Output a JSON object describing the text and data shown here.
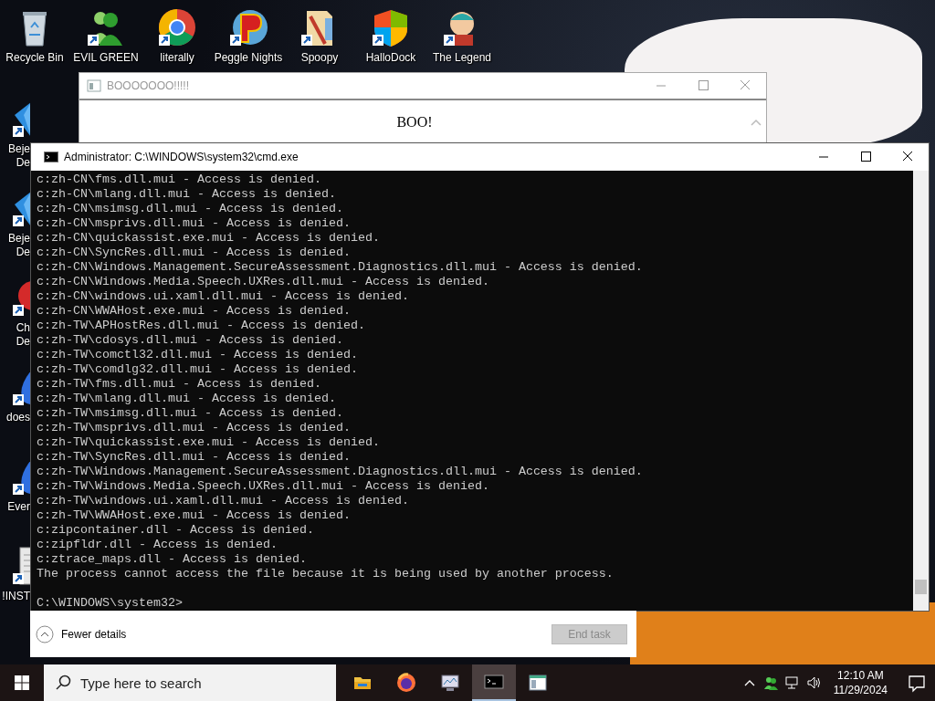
{
  "desktop": {
    "icons": [
      {
        "kind": "recycle_bin",
        "label_lines": [
          "Recycle Bin"
        ]
      },
      {
        "kind": "people",
        "label_lines": [
          "EVIL GREEN"
        ]
      },
      {
        "kind": "chrome",
        "label_lines": [
          "literally"
        ]
      },
      {
        "kind": "peggle",
        "label_lines": [
          "Peggle Nights"
        ]
      },
      {
        "kind": "folder",
        "label_lines": [
          "Spoopy"
        ]
      },
      {
        "kind": "shield",
        "label_lines": [
          "HalloDock"
        ]
      },
      {
        "kind": "character",
        "label_lines": [
          "The Legend"
        ]
      }
    ],
    "side_icons": [
      {
        "kind": "gem",
        "label_lines": [
          "Beje",
          "De"
        ]
      },
      {
        "kind": "gem",
        "label_lines": [
          "Beje",
          "De"
        ]
      },
      {
        "kind": "ball",
        "label_lines": [
          "Ch",
          "De"
        ]
      },
      {
        "kind": "flame",
        "label_lines": [
          "does"
        ]
      },
      {
        "kind": "flame",
        "label_lines": [
          "Ever"
        ]
      },
      {
        "kind": "file",
        "label_lines": [
          "!INST"
        ]
      }
    ]
  },
  "boo_window": {
    "title": "BOOOOOOO!!!!!",
    "message": "BOO!"
  },
  "cmd_window": {
    "title": "Administrator: C:\\WINDOWS\\system32\\cmd.exe",
    "lines": [
      "c:zh-CN\\fms.dll.mui - Access is denied.",
      "c:zh-CN\\mlang.dll.mui - Access is denied.",
      "c:zh-CN\\msimsg.dll.mui - Access is denied.",
      "c:zh-CN\\msprivs.dll.mui - Access is denied.",
      "c:zh-CN\\quickassist.exe.mui - Access is denied.",
      "c:zh-CN\\SyncRes.dll.mui - Access is denied.",
      "c:zh-CN\\Windows.Management.SecureAssessment.Diagnostics.dll.mui - Access is denied.",
      "c:zh-CN\\Windows.Media.Speech.UXRes.dll.mui - Access is denied.",
      "c:zh-CN\\windows.ui.xaml.dll.mui - Access is denied.",
      "c:zh-CN\\WWAHost.exe.mui - Access is denied.",
      "c:zh-TW\\APHostRes.dll.mui - Access is denied.",
      "c:zh-TW\\cdosys.dll.mui - Access is denied.",
      "c:zh-TW\\comctl32.dll.mui - Access is denied.",
      "c:zh-TW\\comdlg32.dll.mui - Access is denied.",
      "c:zh-TW\\fms.dll.mui - Access is denied.",
      "c:zh-TW\\mlang.dll.mui - Access is denied.",
      "c:zh-TW\\msimsg.dll.mui - Access is denied.",
      "c:zh-TW\\msprivs.dll.mui - Access is denied.",
      "c:zh-TW\\quickassist.exe.mui - Access is denied.",
      "c:zh-TW\\SyncRes.dll.mui - Access is denied.",
      "c:zh-TW\\Windows.Management.SecureAssessment.Diagnostics.dll.mui - Access is denied.",
      "c:zh-TW\\Windows.Media.Speech.UXRes.dll.mui - Access is denied.",
      "c:zh-TW\\windows.ui.xaml.dll.mui - Access is denied.",
      "c:zh-TW\\WWAHost.exe.mui - Access is denied.",
      "c:zipcontainer.dll - Access is denied.",
      "c:zipfldr.dll - Access is denied.",
      "c:ztrace_maps.dll - Access is denied.",
      "The process cannot access the file because it is being used by another process."
    ],
    "prompt": "C:\\WINDOWS\\system32>"
  },
  "task_panel": {
    "details_link": "Fewer details",
    "end_task": {
      "label": "End task",
      "disabled": true
    }
  },
  "taskbar": {
    "search": {
      "placeholder": "Type here to search"
    },
    "apps": [
      {
        "kind": "folder",
        "selected": false
      },
      {
        "kind": "firefox",
        "selected": false
      },
      {
        "kind": "monitor",
        "selected": false
      },
      {
        "kind": "terminal",
        "selected": true
      },
      {
        "kind": "window",
        "selected": false
      }
    ],
    "time": "12:10 AM",
    "date": "11/29/2024"
  }
}
